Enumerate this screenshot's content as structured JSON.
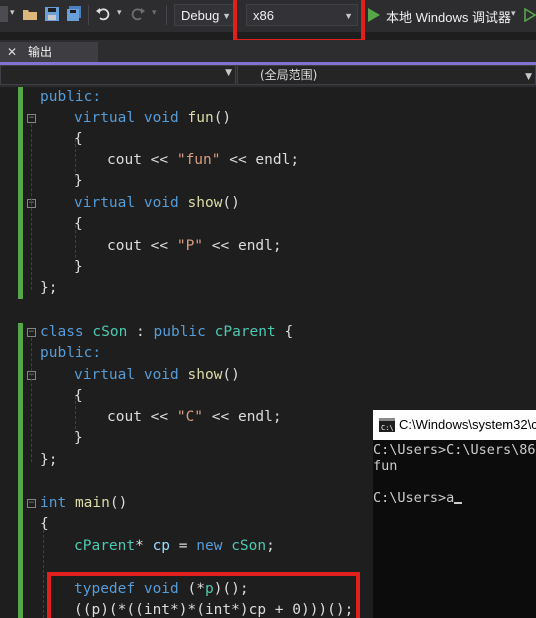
{
  "toolbar": {
    "config": "Debug",
    "platform": "x86",
    "debugger": "本地 Windows 调试器"
  },
  "tabs": {
    "output": "输出"
  },
  "navbar": {
    "scope": "(全局范围)"
  },
  "code": {
    "public1": "public:",
    "virtual_fun": [
      "virtual",
      " ",
      "void",
      " ",
      "fun",
      "()"
    ],
    "brace_open": "{",
    "cout_fun": [
      "cout << ",
      "\"fun\"",
      " << endl;"
    ],
    "brace_close": "}",
    "virtual_show": [
      "virtual",
      " ",
      "void",
      " ",
      "show",
      "()"
    ],
    "cout_p": [
      "cout << ",
      "\"P\"",
      " << endl;"
    ],
    "class_end": "};",
    "class_cson": [
      "class",
      " ",
      "cSon",
      " : ",
      "public",
      " ",
      "cParent",
      " {"
    ],
    "public2": "public:",
    "cout_c": [
      "cout << ",
      "\"C\"",
      " << endl;"
    ],
    "int_main": [
      "int",
      " ",
      "main",
      "()"
    ],
    "cparent_line": [
      "cParent",
      "* ",
      "cp",
      " = ",
      "new",
      " ",
      "cSon",
      ";"
    ],
    "typedef_line": [
      "typedef",
      " ",
      "void",
      " (*",
      "p",
      ")();"
    ],
    "call_line": "((p)(*((int*)*(int*)cp + 0)))();"
  },
  "console": {
    "title": "C:\\Windows\\system32\\c",
    "lines": [
      "C:\\Users>C:\\Users\\86",
      "fun",
      "",
      "C:\\Users>a"
    ]
  },
  "colors": {
    "highlight_box": "#e0201c",
    "keyword": "#569cd6",
    "string": "#d69d85",
    "type": "#4ec9b0",
    "function": "#dcdcaa",
    "change_bar": "#57a64a"
  }
}
